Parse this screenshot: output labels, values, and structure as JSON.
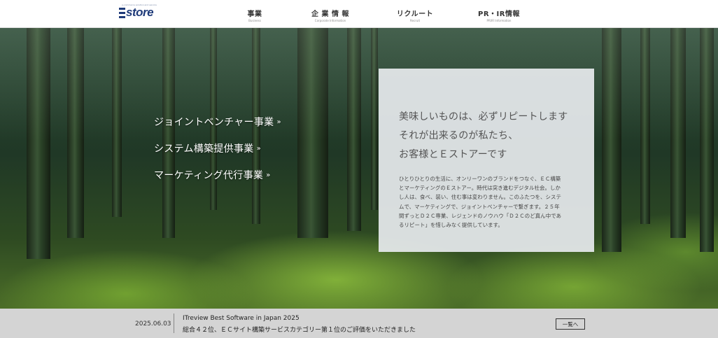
{
  "header": {
    "logo_text": "store",
    "logo_tagline": "e-commerce solution and service",
    "nav": [
      {
        "jp": "事業",
        "en": "Business"
      },
      {
        "jp": "企 業 情 報",
        "en": "Corporate Information"
      },
      {
        "jp": "リクルート",
        "en": "Recruit"
      },
      {
        "jp": "PR・IR情報",
        "en": "PR/IR   Information"
      }
    ]
  },
  "hero": {
    "links": [
      {
        "label": "ジョイントベンチャー事業",
        "icon": "double-chevron-down-icon"
      },
      {
        "label": "システム構築提供事業",
        "icon": "double-chevron-down-icon"
      },
      {
        "label": "マーケティング代行事業",
        "icon": "double-chevron-down-icon"
      }
    ],
    "catch_lines": [
      "美味しいものは、必ずリピートします",
      "それが出来るのが私たち、",
      "お客様とＥストアーです"
    ],
    "body_lines": [
      "ひとりひとりの生活に、オンリーワンのブランドをつなぐ、ＥＣ構築",
      "とマーケティングのＥストアー。時代は突き進むデジタル社会。しか",
      "し人は、食べ、装い、住む事は変わりません。このふたつを、システ",
      "ムで、マーケティングで、ジョイントベンチャーで繋ぎます。２５年",
      "間ずっとＤ２Ｃ専業、レジェンドのノウハウ「Ｄ２Ｃのど真ん中であ",
      "るリピート」を惜しみなく提供しています。"
    ]
  },
  "news": {
    "date": "2025.06.03",
    "title": "ITreview Best Software in Japan 2025",
    "description": "総合４２位、ＥＣサイト構築サービスカテゴリー第１位のご評価をいただきました",
    "button_label": "一覧へ"
  },
  "colors": {
    "brand": "#1f3b7a",
    "news_bar": "#d4d4d4",
    "panel": "#e6e9ed"
  }
}
